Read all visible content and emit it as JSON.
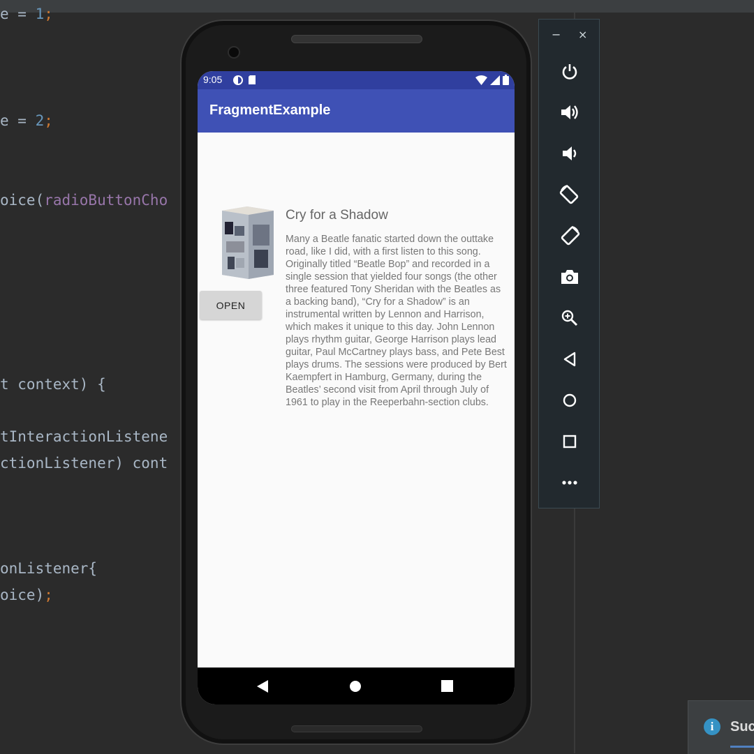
{
  "editor": {
    "lines": [
      {
        "pre": "e = ",
        "num": "1",
        "semi": ";"
      },
      {
        "pre": "e = ",
        "num": "2",
        "semi": ";"
      },
      {
        "pre": "oice(",
        "param": "radioButtonCho"
      },
      {
        "pre": "t context) {"
      },
      {
        "pre": "tInteractionListene"
      },
      {
        "pre": "ctionListener) cont"
      },
      {
        "pre": "onListener{"
      },
      {
        "pre": "oice)",
        "semi": ";"
      }
    ]
  },
  "emulator_window": {
    "minimize_label": "−",
    "close_label": "×",
    "buttons": [
      {
        "name": "power-icon"
      },
      {
        "name": "volume-up-icon"
      },
      {
        "name": "volume-down-icon"
      },
      {
        "name": "rotate-left-icon"
      },
      {
        "name": "rotate-right-icon"
      },
      {
        "name": "camera-icon"
      },
      {
        "name": "zoom-icon"
      },
      {
        "name": "back-icon"
      },
      {
        "name": "home-icon"
      },
      {
        "name": "overview-icon"
      },
      {
        "name": "more-icon"
      }
    ]
  },
  "phone": {
    "status_time": "9:05",
    "app_title": "FragmentExample",
    "open_button": "OPEN",
    "song_title": "Cry for a Shadow",
    "song_description": "Many a Beatle fanatic started down the outtake road, like I did, with a first listen to this song. Originally titled “Beatle Bop” and recorded in a single session that yielded four songs (the other three featured Tony Sheridan with the Beatles as a backing band), “Cry for a Shadow” is an instrumental written by Lennon and Harrison, which makes it unique to this day. John Lennon plays rhythm guitar, George Harrison plays lead guitar, Paul McCartney plays bass, and Pete Best plays drums. The sessions were produced by Bert Kaempfert in Hamburg, Germany, during the Beatles’ second visit from April through July of 1961 to play in the Reeperbahn-section clubs.",
    "album_icon": "album-cover-image"
  },
  "notification": {
    "text": "Suc"
  },
  "colors": {
    "primary": "#3f51b5",
    "primary_dark": "#303f9f",
    "ide_background": "#2b2b2b"
  }
}
